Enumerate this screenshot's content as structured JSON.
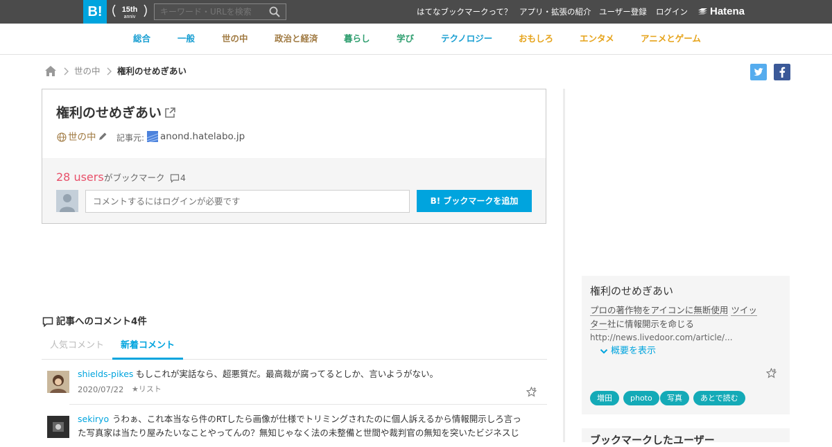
{
  "global_header": {
    "logo_text": "B!",
    "anniv_text": "15th",
    "anniv_sub": "anniv",
    "search_placeholder": "キーワード・URLを検索",
    "nav": [
      "はてなブックマークって？",
      "アプリ・拡張の紹介",
      "ユーザー登録",
      "ログイン"
    ],
    "brand": "Hatena"
  },
  "categories": [
    {
      "label": "総合",
      "color": "#1a9fd2"
    },
    {
      "label": "一般",
      "color": "#1a9fd2"
    },
    {
      "label": "世の中",
      "color": "#a07a42"
    },
    {
      "label": "政治と経済",
      "color": "#a07a42"
    },
    {
      "label": "暮らし",
      "color": "#2f9e6f"
    },
    {
      "label": "学び",
      "color": "#2f9e6f"
    },
    {
      "label": "テクノロジー",
      "color": "#1a9fd2"
    },
    {
      "label": "おもしろ",
      "color": "#e6a31a"
    },
    {
      "label": "エンタメ",
      "color": "#e6a31a"
    },
    {
      "label": "アニメとゲーム",
      "color": "#e6a31a"
    }
  ],
  "breadcrumb": {
    "category": "世の中",
    "current": "権利のせめぎあい"
  },
  "entry": {
    "title": "権利のせめぎあい",
    "category": "世の中",
    "source_label": "記事元:",
    "source_domain": "anond.hatelabo.jp",
    "users": "28 users",
    "users_suffix": "がブックマーク",
    "comment_count": "4",
    "comment_placeholder": "コメントするにはログインが必要です",
    "bookmark_button": "B! ブックマークを追加"
  },
  "comments_section": {
    "title": "記事へのコメント4件",
    "tabs": [
      "人気コメント",
      "新着コメント"
    ],
    "active_tab": "新着コメント",
    "items": [
      {
        "user": "shields-pikes",
        "text": "もしこれが実話なら、超悪質だ。最高裁が腐ってるとしか、言いようがない。",
        "date": "2020/07/22",
        "list_label": "★リスト"
      },
      {
        "user": "sekiryo",
        "text_line1": "うわぁ、これ本当なら件のRTしたら画像が仕様でトリミングされたのに個人訴えるから情報開示しろ言っ",
        "text_line2": "た写真家は当たり屋みたいなことやってんの？無知じゃなく法の未整備と世間や裁判官の無知を突いたビジネスじ"
      }
    ]
  },
  "sidebar": {
    "title": "権利のせめぎあい",
    "desc_part1": "プロの著作物をアイコンに無断使用",
    "desc_part2": "ツイッ",
    "desc_part3": "ター",
    "desc_part4": "社に情報開示を命じる",
    "url": "http://news.livedoor.com/article/...",
    "toggle": "概要を表示",
    "tags": [
      "増田",
      "photo",
      "写真",
      "あとで読む"
    ],
    "next_heading": "ブックマークしたユーザー"
  },
  "colors": {
    "accent": "#00a4de",
    "users_red": "#e8506a",
    "tag_teal": "#14aab7"
  }
}
